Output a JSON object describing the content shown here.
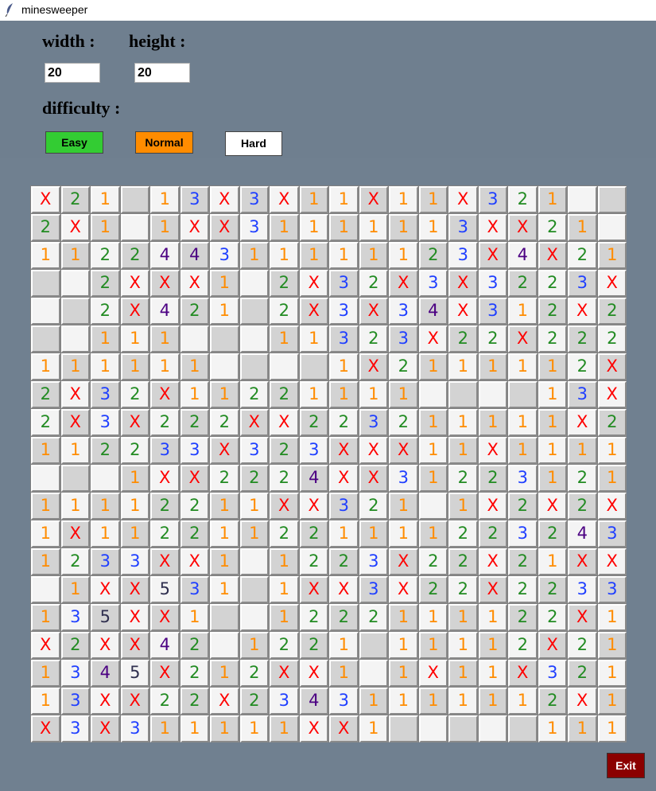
{
  "window": {
    "title": "minesweeper",
    "icon": "feather-icon"
  },
  "labels": {
    "width": "width :",
    "height": "height :",
    "difficulty": "difficulty :"
  },
  "inputs": {
    "width_value": "20",
    "height_value": "20"
  },
  "buttons": {
    "easy": {
      "label": "Easy",
      "color": "#33cc33"
    },
    "normal": {
      "label": "Normal",
      "color": "#ff8c00"
    },
    "hard": {
      "label": "Hard",
      "color": "#ffffff"
    },
    "exit": {
      "label": "Exit",
      "color": "#8b0000"
    }
  },
  "colors": {
    "1": "#ff8c00",
    "2": "#228b22",
    "3": "#1f3fff",
    "4": "#4b0082",
    "5": "#2f2f4f",
    "X": "#ff0000"
  },
  "board": {
    "rows": [
      [
        "X",
        "2",
        "1",
        "",
        "1",
        "3",
        "X",
        "3",
        "X",
        "1",
        "1",
        "X",
        "1",
        "1",
        "X",
        "3",
        "2",
        "1",
        "",
        ""
      ],
      [
        "2",
        "X",
        "1",
        "",
        "1",
        "X",
        "X",
        "3",
        "1",
        "1",
        "1",
        "1",
        "1",
        "1",
        "3",
        "X",
        "X",
        "2",
        "1",
        ""
      ],
      [
        "1",
        "1",
        "2",
        "2",
        "4",
        "4",
        "3",
        "1",
        "1",
        "1",
        "1",
        "1",
        "1",
        "2",
        "3",
        "X",
        "4",
        "X",
        "2",
        "1"
      ],
      [
        "",
        "",
        "2",
        "X",
        "X",
        "X",
        "1",
        "",
        "2",
        "X",
        "3",
        "2",
        "X",
        "3",
        "X",
        "3",
        "2",
        "2",
        "3",
        "X"
      ],
      [
        "",
        "",
        "2",
        "X",
        "4",
        "2",
        "1",
        "",
        "2",
        "X",
        "3",
        "X",
        "3",
        "4",
        "X",
        "3",
        "1",
        "2",
        "X",
        "2"
      ],
      [
        "",
        "",
        "1",
        "1",
        "1",
        "",
        "",
        "",
        "1",
        "1",
        "3",
        "2",
        "3",
        "X",
        "2",
        "2",
        "X",
        "2",
        "2",
        "2"
      ],
      [
        "1",
        "1",
        "1",
        "1",
        "1",
        "1",
        "",
        "",
        "",
        "",
        "1",
        "X",
        "2",
        "1",
        "1",
        "1",
        "1",
        "1",
        "2",
        "X"
      ],
      [
        "2",
        "X",
        "3",
        "2",
        "X",
        "1",
        "1",
        "2",
        "2",
        "1",
        "1",
        "1",
        "1",
        "",
        "",
        "",
        "",
        "1",
        "3",
        "X"
      ],
      [
        "2",
        "X",
        "3",
        "X",
        "2",
        "2",
        "2",
        "X",
        "X",
        "2",
        "2",
        "3",
        "2",
        "1",
        "1",
        "1",
        "1",
        "1",
        "X",
        "2"
      ],
      [
        "1",
        "1",
        "2",
        "2",
        "3",
        "3",
        "X",
        "3",
        "2",
        "3",
        "X",
        "X",
        "X",
        "1",
        "1",
        "X",
        "1",
        "1",
        "1",
        "1"
      ],
      [
        "",
        "",
        "",
        "1",
        "X",
        "X",
        "2",
        "2",
        "2",
        "4",
        "X",
        "X",
        "3",
        "1",
        "2",
        "2",
        "3",
        "1",
        "2",
        "1"
      ],
      [
        "1",
        "1",
        "1",
        "1",
        "2",
        "2",
        "1",
        "1",
        "X",
        "X",
        "3",
        "2",
        "1",
        "",
        "1",
        "X",
        "2",
        "X",
        "2",
        "X"
      ],
      [
        "1",
        "X",
        "1",
        "1",
        "2",
        "2",
        "1",
        "1",
        "2",
        "2",
        "1",
        "1",
        "1",
        "1",
        "2",
        "2",
        "3",
        "2",
        "4",
        "3"
      ],
      [
        "1",
        "2",
        "3",
        "3",
        "X",
        "X",
        "1",
        "",
        "1",
        "2",
        "2",
        "3",
        "X",
        "2",
        "2",
        "X",
        "2",
        "1",
        "X",
        "X"
      ],
      [
        "",
        "1",
        "X",
        "X",
        "5",
        "3",
        "1",
        "",
        "1",
        "X",
        "X",
        "3",
        "X",
        "2",
        "2",
        "X",
        "2",
        "2",
        "3",
        "3"
      ],
      [
        "1",
        "3",
        "5",
        "X",
        "X",
        "1",
        "",
        "",
        "1",
        "2",
        "2",
        "2",
        "1",
        "1",
        "1",
        "1",
        "2",
        "2",
        "X",
        "1"
      ],
      [
        "X",
        "2",
        "X",
        "X",
        "4",
        "2",
        "",
        "1",
        "2",
        "2",
        "1",
        "",
        "1",
        "1",
        "1",
        "1",
        "2",
        "X",
        "2",
        "1"
      ],
      [
        "1",
        "3",
        "4",
        "5",
        "X",
        "2",
        "1",
        "2",
        "X",
        "X",
        "1",
        "",
        "1",
        "X",
        "1",
        "1",
        "X",
        "3",
        "2",
        "1"
      ],
      [
        "1",
        "3",
        "X",
        "X",
        "2",
        "2",
        "X",
        "2",
        "3",
        "4",
        "3",
        "1",
        "1",
        "1",
        "1",
        "1",
        "1",
        "2",
        "X",
        "1"
      ],
      [
        "X",
        "3",
        "X",
        "3",
        "1",
        "1",
        "1",
        "1",
        "1",
        "X",
        "X",
        "1",
        "",
        "",
        "",
        "",
        "",
        "1",
        "1",
        "1"
      ]
    ]
  }
}
